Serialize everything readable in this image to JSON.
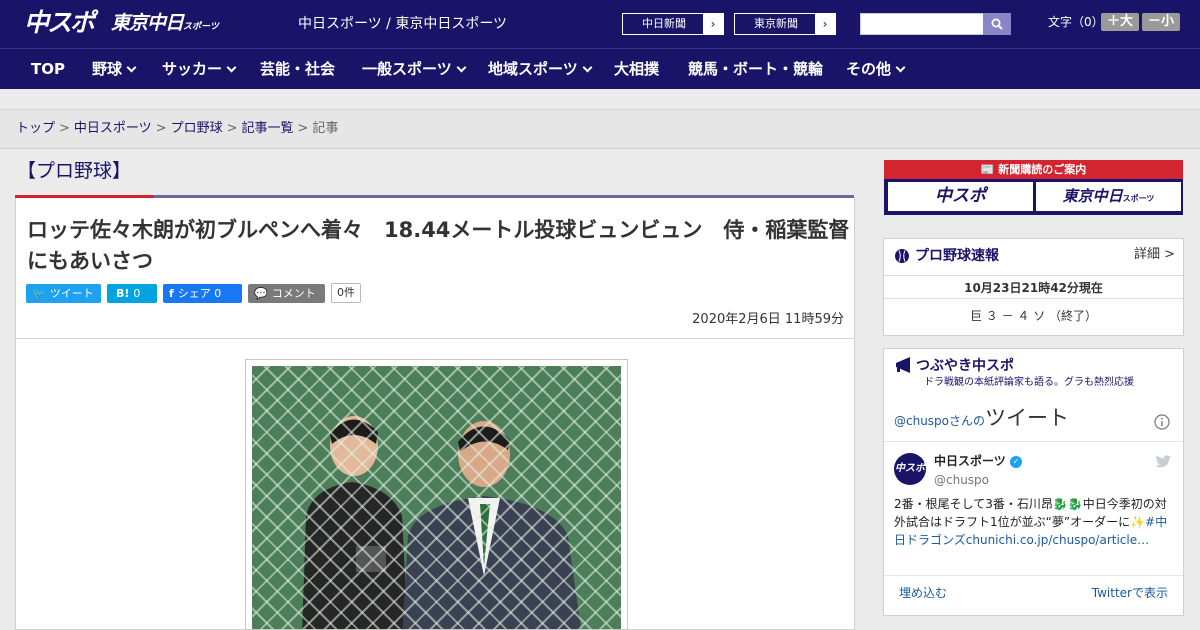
{
  "header": {
    "logo_main": "中スポ",
    "logo_sub": "東京中日",
    "logo_sub_small": "スポーツ",
    "site_name": "中日スポーツ / 東京中日スポーツ",
    "paper_links": [
      {
        "label": "中日新聞",
        "arrow": "›"
      },
      {
        "label": "東京新聞",
        "arrow": "›"
      }
    ],
    "search_placeholder": "",
    "fontsize_label": "文字（0）",
    "fontsize_up": "＋大",
    "fontsize_down": "－小"
  },
  "nav": {
    "items": [
      {
        "label": "TOP"
      },
      {
        "label": "野球"
      },
      {
        "label": "サッカー"
      },
      {
        "label": "芸能・社会"
      },
      {
        "label": "一般スポーツ"
      },
      {
        "label": "地域スポーツ"
      },
      {
        "label": "大相撲"
      },
      {
        "label": "競馬・ボート・競輪"
      },
      {
        "label": "その他"
      }
    ]
  },
  "breadcrumb": {
    "items": [
      "トップ",
      "中日スポーツ",
      "プロ野球",
      "記事一覧",
      "記事"
    ],
    "separator": ">"
  },
  "article": {
    "category": "【プロ野球】",
    "headline": "ロッテ佐々木朗が初ブルペンへ着々　18.44メートル投球ビュンビュン　侍・稲葉監督にもあいさつ",
    "share": {
      "tweet": "ツイート",
      "hatena_icon": "B!",
      "hatena_count": "0",
      "facebook": "シェア 0",
      "comment": "コメント",
      "comment_count": "0件"
    },
    "date": "2020年2月6日 11時59分"
  },
  "sidebar": {
    "subscribe": {
      "title": "新聞購読のご案内",
      "btn_chuspo": "中スポ",
      "btn_tokyo": "東京中日",
      "btn_tokyo_small": "スポーツ"
    },
    "scoreboard": {
      "title": "プロ野球速報",
      "detail": "詳細 >",
      "time": "10月23日21時42分現在",
      "game": "巨 ３ － ４ ソ （終了）"
    },
    "twitter": {
      "title": "つぶやき中スポ",
      "subtitle": "ドラ戦観の本紙評論家も語る。グラも熱烈応援",
      "account": "@chuspo",
      "account_suffix": "さんの",
      "account_big": "ツイート",
      "avatar_text": "中スポ",
      "name": "中日スポーツ",
      "handle": "@chuspo",
      "text_main": "2番・根尾そして3番・石川昂🐉🐉中日今季初の対外試合はドラフト1位が並ぶ“夢”オーダーに✨",
      "text_link": "#中日ドラゴンズchunichi.co.jp/chuspo/article…",
      "embed": "埋め込む",
      "view": "Twitterで表示"
    }
  },
  "colors": {
    "brand_navy": "#1a1468",
    "accent_red": "#d2252f",
    "twitter_blue": "#1da1f2",
    "hatena_blue": "#00a4de",
    "facebook_blue": "#1877f2"
  }
}
